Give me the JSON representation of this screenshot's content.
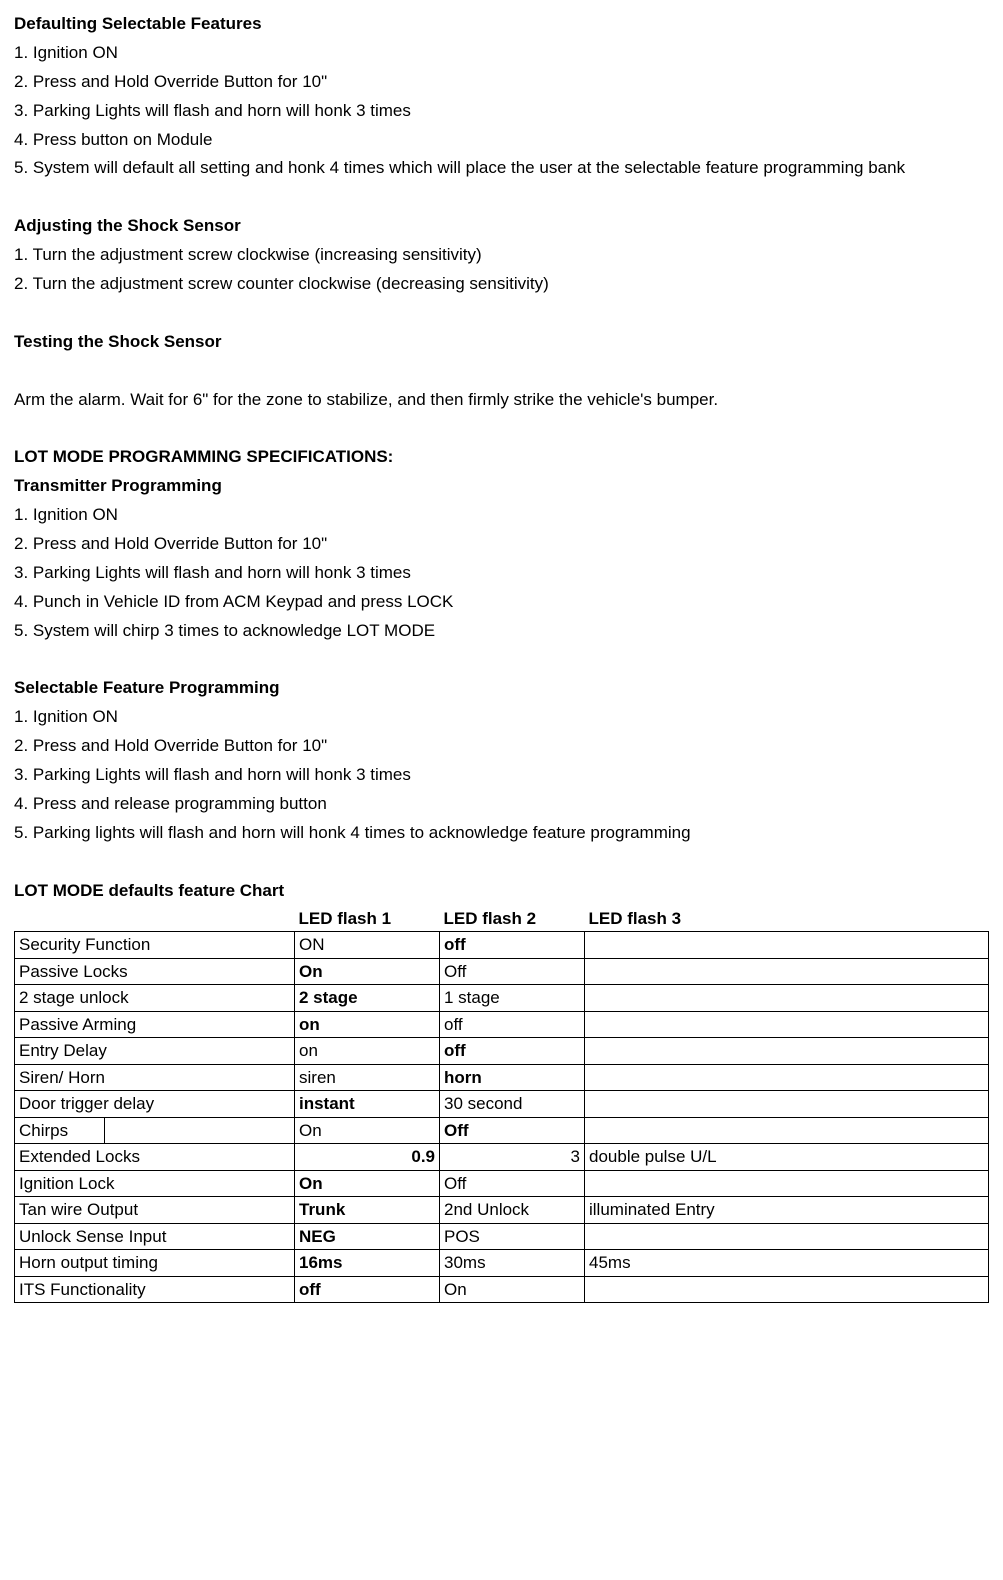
{
  "sections": {
    "defaulting": {
      "heading": "Defaulting Selectable Features",
      "steps": [
        "1. Ignition ON",
        "2. Press and Hold Override Button for 10\"",
        "3. Parking Lights will flash and horn will honk 3 times",
        "4. Press button on Module",
        "5. System will default all setting and honk 4 times which will place the user at the selectable feature programming bank"
      ]
    },
    "adjusting": {
      "heading": "Adjusting the Shock Sensor",
      "steps": [
        "1. Turn the adjustment screw clockwise (increasing sensitivity)",
        "2. Turn the adjustment screw counter clockwise (decreasing sensitivity)"
      ]
    },
    "testing": {
      "heading": "Testing the Shock Sensor",
      "body": "Arm the alarm. Wait for 6\" for the zone to stabilize, and then firmly strike the vehicle's bumper."
    },
    "lotmode_spec_heading": "LOT MODE PROGRAMMING SPECIFICATIONS:",
    "transmitter": {
      "heading": "Transmitter Programming",
      "steps": [
        "1. Ignition ON",
        "2. Press and Hold Override Button for 10\"",
        "3. Parking Lights will flash and horn will honk 3 times",
        "4. Punch in Vehicle ID from ACM Keypad and press LOCK",
        "5. System will chirp 3 times to acknowledge LOT MODE"
      ]
    },
    "selectable": {
      "heading": "Selectable Feature Programming",
      "steps": [
        "1. Ignition ON",
        "2. Press and Hold Override Button for 10\"",
        "3. Parking Lights will flash and horn will honk 3 times",
        "4. Press and release programming button",
        "5. Parking lights will flash and horn will honk 4 times to acknowledge feature programming"
      ]
    },
    "chart_heading": "LOT MODE defaults feature Chart"
  },
  "chart_data": {
    "type": "table",
    "headers": [
      "",
      "LED flash 1",
      "LED flash 2",
      "LED flash 3"
    ],
    "rows": [
      {
        "label_a": "Security Function",
        "label_b": "",
        "led1": "ON",
        "led1_bold": false,
        "led2": "off",
        "led2_bold": true,
        "led3": "",
        "led3_bold": false
      },
      {
        "label_a": "Passive Locks",
        "label_b": "",
        "led1": "On",
        "led1_bold": true,
        "led2": "Off",
        "led2_bold": false,
        "led3": "",
        "led3_bold": false
      },
      {
        "label_a": "2 stage unlock",
        "label_b": "",
        "led1": "2 stage",
        "led1_bold": true,
        "led2": "1 stage",
        "led2_bold": false,
        "led3": "",
        "led3_bold": false
      },
      {
        "label_a": "Passive Arming",
        "label_b": "",
        "led1": "on",
        "led1_bold": true,
        "led2": "off",
        "led2_bold": false,
        "led3": "",
        "led3_bold": false
      },
      {
        "label_a": "Entry Delay",
        "label_b": "",
        "led1": "on",
        "led1_bold": false,
        "led2": "off",
        "led2_bold": true,
        "led3": "",
        "led3_bold": false
      },
      {
        "label_a": "Siren/ Horn",
        "label_b": "",
        "led1": "siren",
        "led1_bold": false,
        "led2": "horn",
        "led2_bold": true,
        "led3": "",
        "led3_bold": false
      },
      {
        "label_a": "Door trigger delay",
        "label_b": "",
        "led1": "instant",
        "led1_bold": true,
        "led2": "30 second",
        "led2_bold": false,
        "led3": "",
        "led3_bold": false
      },
      {
        "label_a": "Chirps",
        "split_label": true,
        "label_b": "",
        "led1": "On",
        "led1_bold": false,
        "led2": "Off",
        "led2_bold": true,
        "led3": "",
        "led3_bold": false
      },
      {
        "label_a": "Extended Locks",
        "label_b": "",
        "led1": "0.9",
        "led1_num": true,
        "led1_bold": true,
        "led2": "3",
        "led2_num": true,
        "led2_bold": false,
        "led3": "double pulse U/L",
        "led3_bold": false
      },
      {
        "label_a": "Ignition Lock",
        "label_b": "",
        "led1": "On",
        "led1_bold": true,
        "led2": "Off",
        "led2_bold": false,
        "led3": "",
        "led3_bold": false
      },
      {
        "label_a": "Tan wire Output",
        "label_b": "",
        "led1": "Trunk",
        "led1_bold": true,
        "led2": "2nd Unlock",
        "led2_bold": false,
        "led3": "illuminated Entry",
        "led3_bold": false
      },
      {
        "label_a": "Unlock Sense Input",
        "label_b": "",
        "led1": "NEG",
        "led1_bold": true,
        "led2": "POS",
        "led2_bold": false,
        "led3": "",
        "led3_bold": false
      },
      {
        "label_a": "Horn output timing",
        "label_b": "",
        "led1": "16ms",
        "led1_bold": true,
        "led2": "30ms",
        "led2_bold": false,
        "led3": "45ms",
        "led3_bold": false
      },
      {
        "label_a": "ITS Functionality",
        "label_b": "",
        "led1": "off",
        "led1_bold": true,
        "led2": "On",
        "led2_bold": false,
        "led3": "",
        "led3_bold": false
      }
    ]
  }
}
